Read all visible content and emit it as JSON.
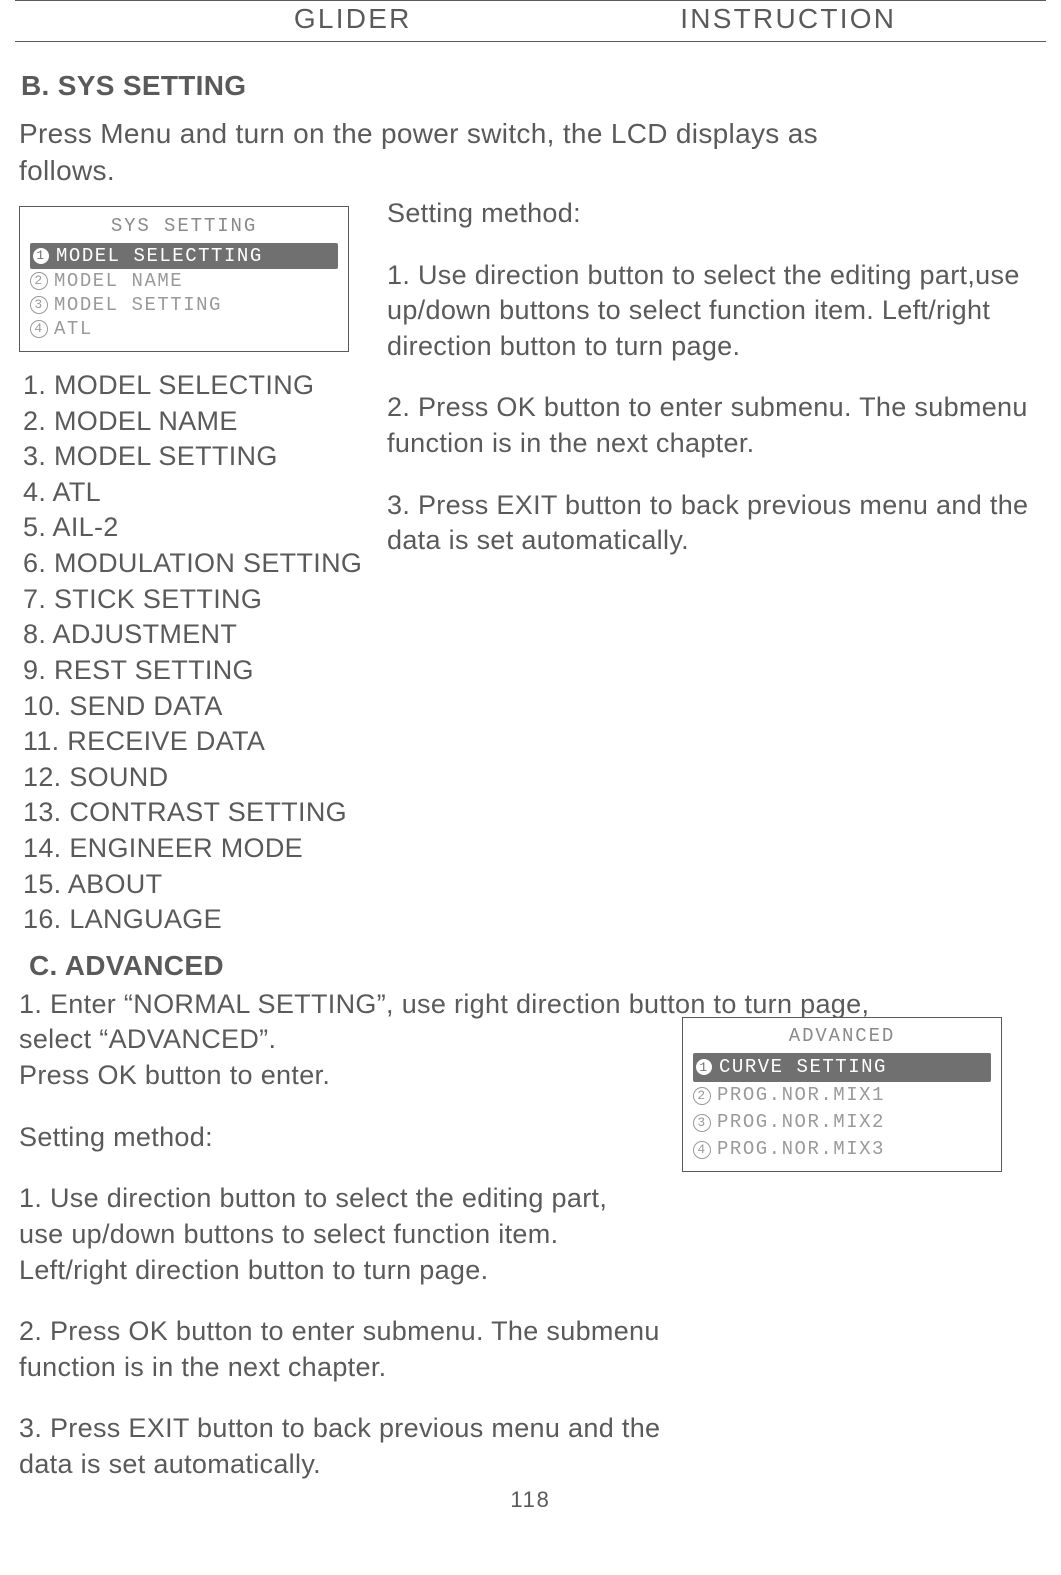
{
  "header": {
    "left": "GLIDER",
    "right": "INSTRUCTION"
  },
  "sectionB": {
    "title": "B. SYS SETTING",
    "intro1": "Press Menu and turn on the power switch, the LCD displays as",
    "intro2": " follows.",
    "lcd": {
      "title": "SYS SETTING",
      "rows": [
        {
          "n": "1",
          "label": "MODEL SELECTTING",
          "selected": true
        },
        {
          "n": "2",
          "label": "MODEL NAME",
          "selected": false
        },
        {
          "n": "3",
          "label": "MODEL SETTING",
          "selected": false
        },
        {
          "n": "4",
          "label": "ATL",
          "selected": false
        }
      ]
    },
    "list": [
      "1. MODEL SELECTING",
      "2. MODEL NAME",
      "3. MODEL SETTING",
      "4. ATL",
      "5. AIL-2",
      "6. MODULATION SETTING",
      "7. STICK SETTING",
      "8. ADJUSTMENT",
      "9. REST SETTING",
      "10. SEND DATA",
      "11. RECEIVE DATA",
      "12. SOUND",
      "13. CONTRAST SETTING",
      "14. ENGINEER MODE",
      "15. ABOUT",
      "16. LANGUAGE"
    ],
    "right": {
      "heading": "Setting method:",
      "p1": "1. Use direction button to select the editing part,use up/down buttons to select function item. Left/right direction button to turn page.",
      "p2": "2. Press OK button to enter submenu. The submenu function is in the next chapter.",
      "p3": "3. Press EXIT button to back previous menu and the data is set automatically."
    }
  },
  "sectionC": {
    "title": "C. ADVANCED",
    "intro1": "1. Enter “NORMAL SETTING”, use right direction button to turn page,",
    "intro2": "select “ADVANCED”.",
    "intro3": "Press OK button to enter.",
    "lcd": {
      "title": "ADVANCED",
      "rows": [
        {
          "n": "1",
          "label": "CURVE SETTING",
          "selected": true
        },
        {
          "n": "2",
          "label": "PROG.NOR.MIX1",
          "selected": false
        },
        {
          "n": "3",
          "label": "PROG.NOR.MIX2",
          "selected": false
        },
        {
          "n": "4",
          "label": "PROG.NOR.MIX3",
          "selected": false
        }
      ]
    },
    "heading": "Setting method:",
    "p1a": "1. Use direction button to select the editing part,",
    "p1b": "use up/down buttons to select function item.",
    "p1c": "Left/right direction button to turn page.",
    "p2a": "2. Press OK button to enter submenu. The submenu",
    "p2b": "function is in the next chapter.",
    "p3a": "3. Press EXIT button to back previous menu and the",
    "p3b": "data is set automatically."
  },
  "pageNumber": "118"
}
